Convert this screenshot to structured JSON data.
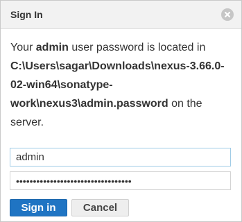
{
  "dialog": {
    "title": "Sign In",
    "close_icon": "close-icon",
    "message": {
      "part1": "Your ",
      "bold1": "admin",
      "part2": " user password is located in ",
      "path": "C:\\Users\\sagar\\Downloads\\nexus-3.66.0-02-win64\\sonatype-work\\nexus3\\admin.password",
      "part3": " on the server."
    }
  },
  "form": {
    "username_value": "admin",
    "password_value": "••••••••••••••••••••••••••••••••••"
  },
  "buttons": {
    "sign_in_label": "Sign in",
    "cancel_label": "Cancel"
  },
  "colors": {
    "primary_button": "#1f74c3",
    "focus_border": "#9fcbe6",
    "title_bar": "#f2f2f2"
  }
}
